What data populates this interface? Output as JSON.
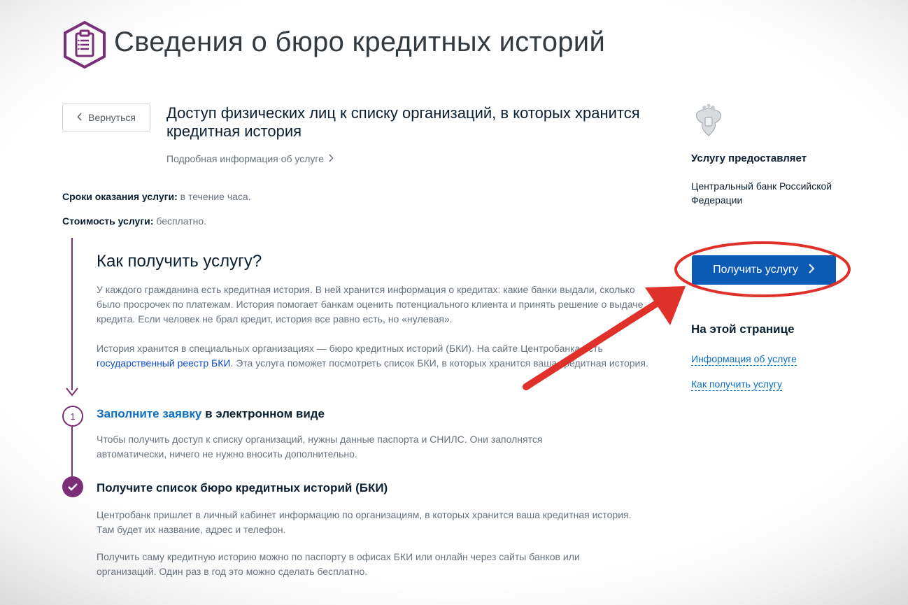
{
  "page_title": "Сведения о бюро кредитных историй",
  "back_button": {
    "label": "Вернуться"
  },
  "service": {
    "title": "Доступ физических лиц к списку организаций, в которых хранится кредитная история",
    "details_link": "Подробная информация об услуге"
  },
  "meta": {
    "term_label": "Сроки оказания услуги:",
    "term_value": " в течение часа.",
    "cost_label": "Стоимость услуги:",
    "cost_value": " бесплатно."
  },
  "how_to": {
    "heading": "Как получить услугу?",
    "para1": "У каждого гражданина есть кредитная история. В ней хранится информация о кредитах: какие банки выдали, сколько было просрочек по платежам. История помогает банкам оценить потенциального клиента и принять решение о выдаче кредита. Если человек не брал кредит, история все равно есть, но «нулевая».",
    "para2_before": "История хранится в специальных организациях — бюро кредитных историй (БКИ). На сайте Центробанка есть ",
    "para2_link": "государственный реестр БКИ",
    "para2_after": ". Эта услуга поможет посмотреть список БКИ, в которых хранится ваша кредитная история."
  },
  "steps": [
    {
      "number": "1",
      "title_link": "Заполните заявку",
      "title_rest": " в электронном виде",
      "text": "Чтобы получить доступ к списку организаций, нужны данные паспорта и СНИЛС. Они заполнятся автоматически, ничего не нужно вносить дополнительно."
    },
    {
      "title": "Получите список бюро кредитных историй (БКИ)",
      "text1": "Центробанк пришлет в личный кабинет информацию по организациям, в которых хранится ваша кредитная история. Там будет их название, адрес и телефон.",
      "text2": "Получить саму кредитную историю можно по паспорту в офисах БКИ или онлайн через сайты банков или организаций. Один раз в год это можно сделать бесплатно."
    }
  ],
  "sidebar": {
    "provider_heading": "Услугу предоставляет",
    "provider_name": "Центральный банк Российской Федерации",
    "cta_label": "Получить услугу",
    "on_page_heading": "На этой странице",
    "links": [
      "Информация об услуге",
      "Как получить услугу"
    ]
  },
  "colors": {
    "accent_purple": "#7a2e77",
    "cta_blue": "#0b5bb5",
    "link_blue": "#0d6fbf",
    "annotation_red": "#e0302a"
  },
  "icons": [
    "clipboard-icon",
    "chevron-left-icon",
    "chevron-right-icon",
    "arrow-down-icon",
    "check-icon",
    "coat-of-arms-icon"
  ]
}
